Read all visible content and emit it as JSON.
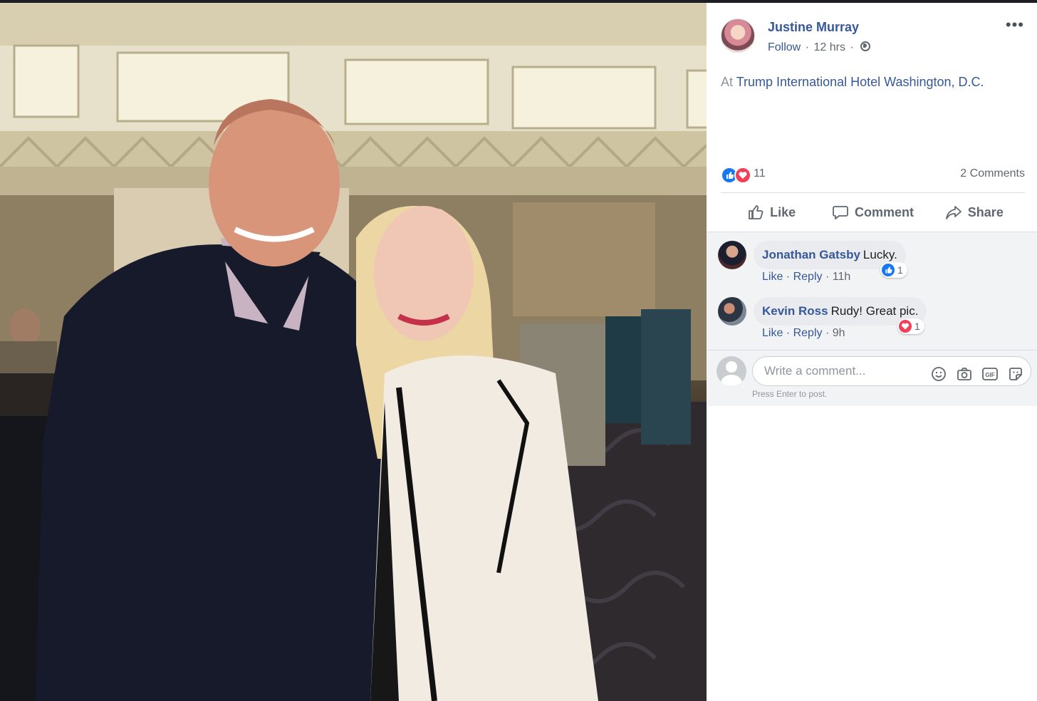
{
  "post": {
    "author": "Justine Murray",
    "follow_label": "Follow",
    "time": "12 hrs",
    "dot": "·",
    "more_label": "•••",
    "checkin_prefix": "At",
    "checkin_place": "Trump International Hotel Washington, D.C.",
    "reactions_count": "11",
    "comments_count": "2 Comments"
  },
  "actions": {
    "like": "Like",
    "comment": "Comment",
    "share": "Share"
  },
  "comments": [
    {
      "name": "Jonathan Gatsby",
      "text": "Lucky.",
      "like_label": "Like",
      "reply_label": "Reply",
      "time": "11h",
      "reaction_icon": "like-icon",
      "reaction_count": "1"
    },
    {
      "name": "Kevin Ross",
      "text": "Rudy! Great pic.",
      "like_label": "Like",
      "reply_label": "Reply",
      "time": "9h",
      "reaction_icon": "love-icon",
      "reaction_count": "1"
    }
  ],
  "composer": {
    "placeholder": "Write a comment...",
    "hint": "Press Enter to post.",
    "icons": [
      "emoji-icon",
      "camera-icon",
      "gif-icon",
      "sticker-icon"
    ]
  },
  "colors": {
    "link_blue": "#365899",
    "like_blue": "#1877f2",
    "love_red": "#f33e58",
    "comment_area_bg": "#f2f3f5"
  }
}
